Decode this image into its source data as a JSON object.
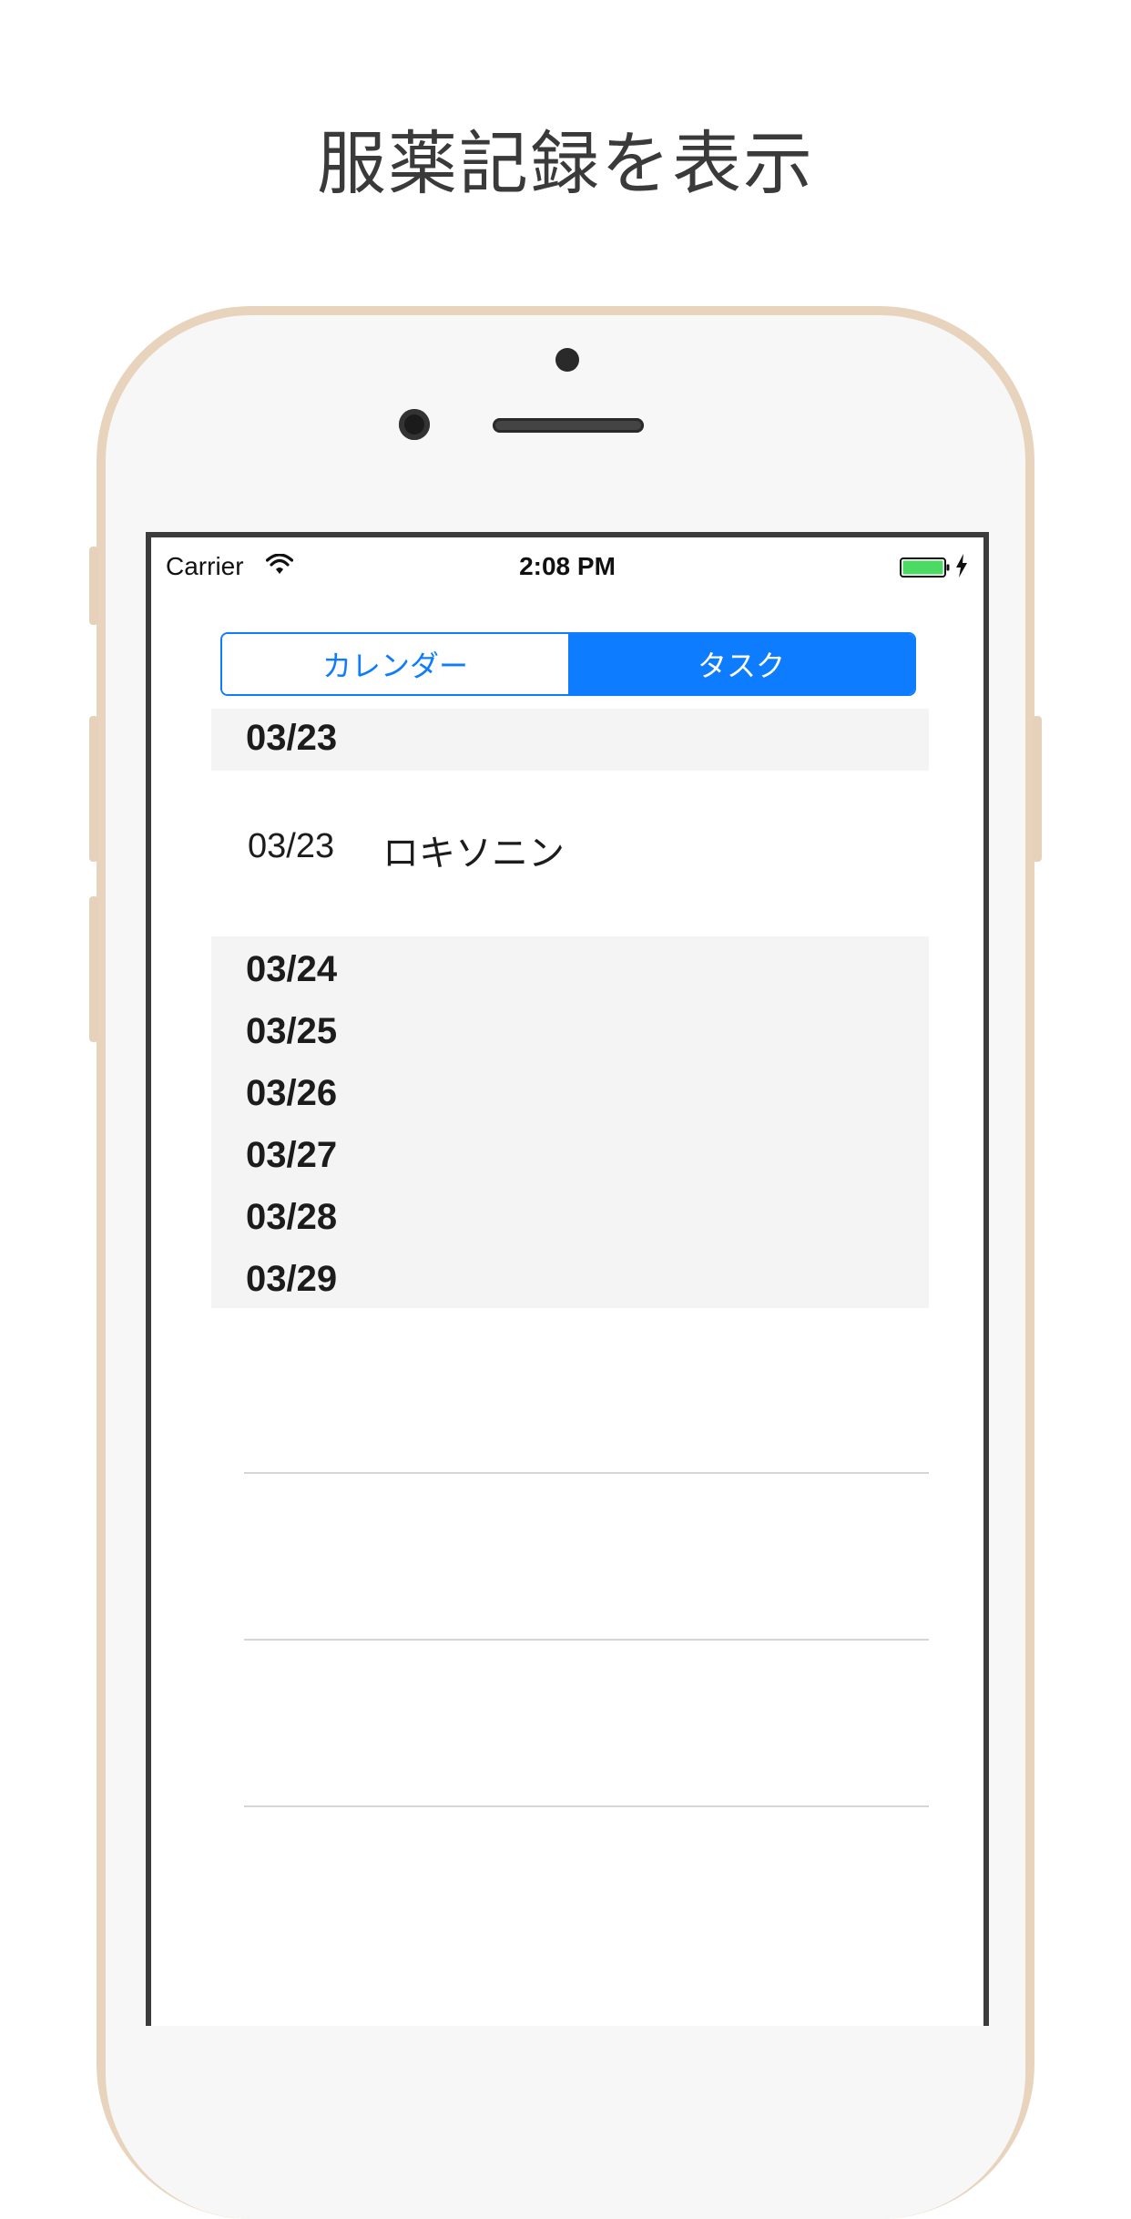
{
  "promo": {
    "title": "服薬記録を表示"
  },
  "status_bar": {
    "carrier": "Carrier",
    "time": "2:08 PM",
    "battery_color": "#4cd964"
  },
  "segmented_control": {
    "segments": [
      "カレンダー",
      "タスク"
    ],
    "selected_index": 1,
    "accent_color": "#0e7cff"
  },
  "table": {
    "sections": [
      {
        "header": "03/23",
        "rows": [
          {
            "date": "03/23",
            "name": "ロキソニン"
          }
        ]
      },
      {
        "header": "03/24",
        "rows": []
      },
      {
        "header": "03/25",
        "rows": []
      },
      {
        "header": "03/26",
        "rows": []
      },
      {
        "header": "03/27",
        "rows": []
      },
      {
        "header": "03/28",
        "rows": []
      },
      {
        "header": "03/29",
        "rows": []
      }
    ]
  }
}
